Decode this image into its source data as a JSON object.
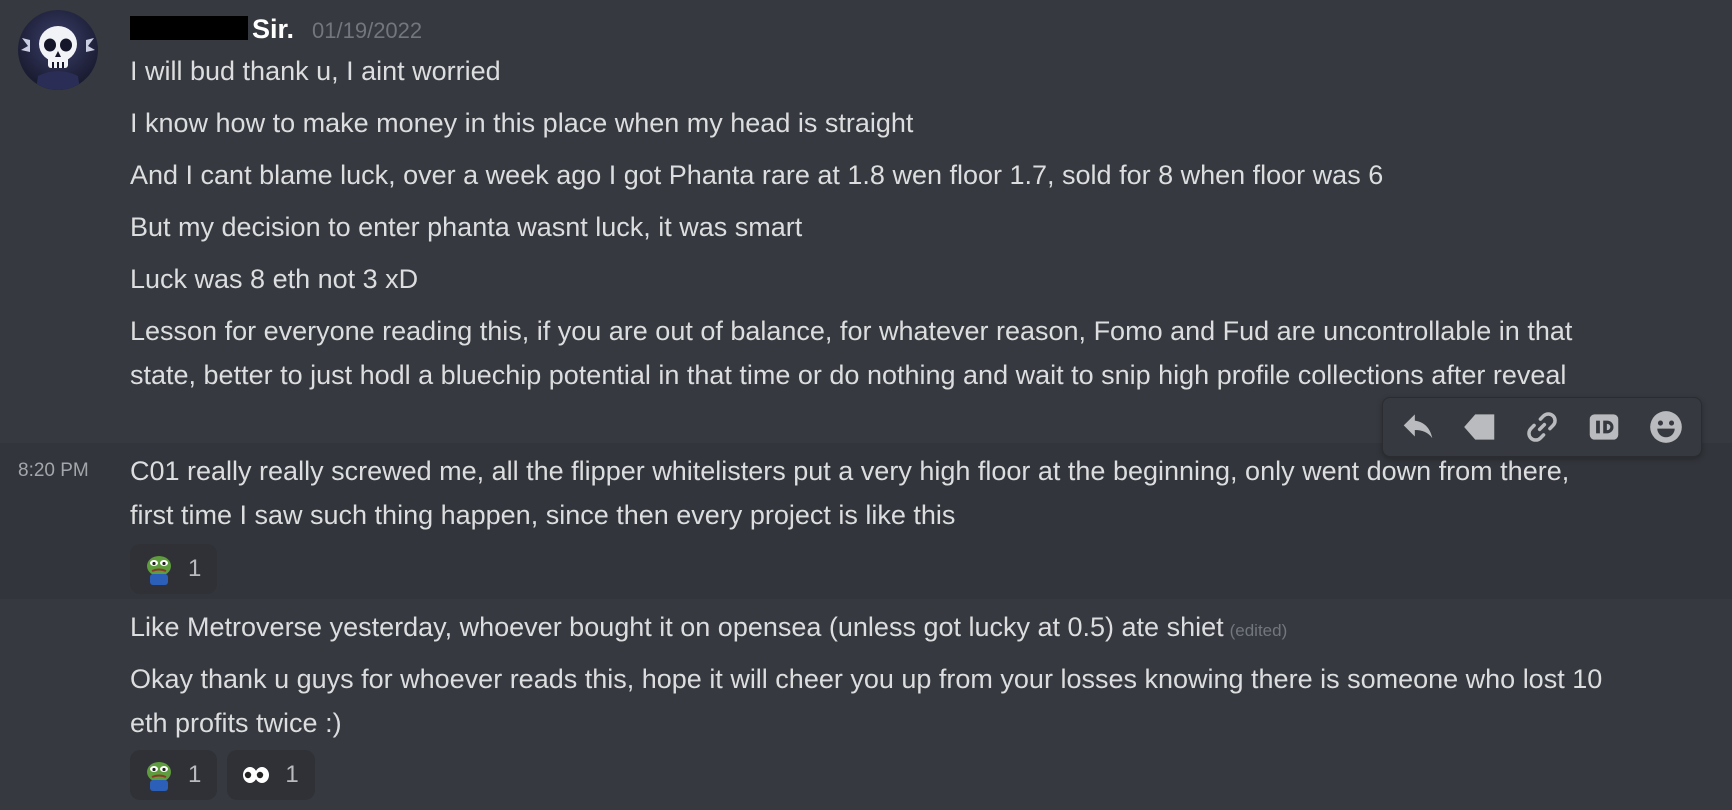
{
  "header": {
    "username_visible": "Sir.",
    "date": "01/19/2022"
  },
  "messages": [
    "I will bud thank u, I aint worried",
    "I know how to make money in this place when my head is straight",
    "And I cant blame luck, over a week ago I got Phanta rare at 1.8 wen floor 1.7, sold for 8 when floor was 6",
    "But my decision to enter phanta wasnt luck, it was smart",
    "Luck was 8 eth not 3 xD",
    "Lesson for everyone reading this, if you are out of balance, for whatever reason, Fomo and Fud are uncontrollable in that state, better to just hodl a bluechip potential in that time or do nothing and wait to snip high profile collections after reveal",
    "C01 really really screwed me, all the flipper whitelisters put a very high floor at the beginning, only went down from there, first time I saw such thing happen, since then every project is like this",
    "Like Metroverse yesterday, whoever bought it on opensea (unless got lucky at 0.5) ate shiet",
    "Okay thank u guys for whoever reads this, hope it will cheer you up from your losses knowing there is someone who lost 10 eth profits twice :)"
  ],
  "hovered_timestamp": "8:20 PM",
  "edited_label": "(edited)",
  "reactions_c01": [
    {
      "emoji": "pepe-sad-icon",
      "count": "1"
    }
  ],
  "reactions_last": [
    {
      "emoji": "pepe-sad-icon",
      "count": "1"
    },
    {
      "emoji": "eyes-icon",
      "count": "1"
    }
  ],
  "toolbar": {
    "icons": [
      "reply-icon",
      "tag-icon",
      "link-icon",
      "id-icon",
      "add-reaction-icon"
    ]
  },
  "colors": {
    "background": "#36393f",
    "hover_background": "#32353b",
    "text": "#dcddde",
    "muted": "#72767d",
    "reaction_bg": "#2f3136"
  }
}
